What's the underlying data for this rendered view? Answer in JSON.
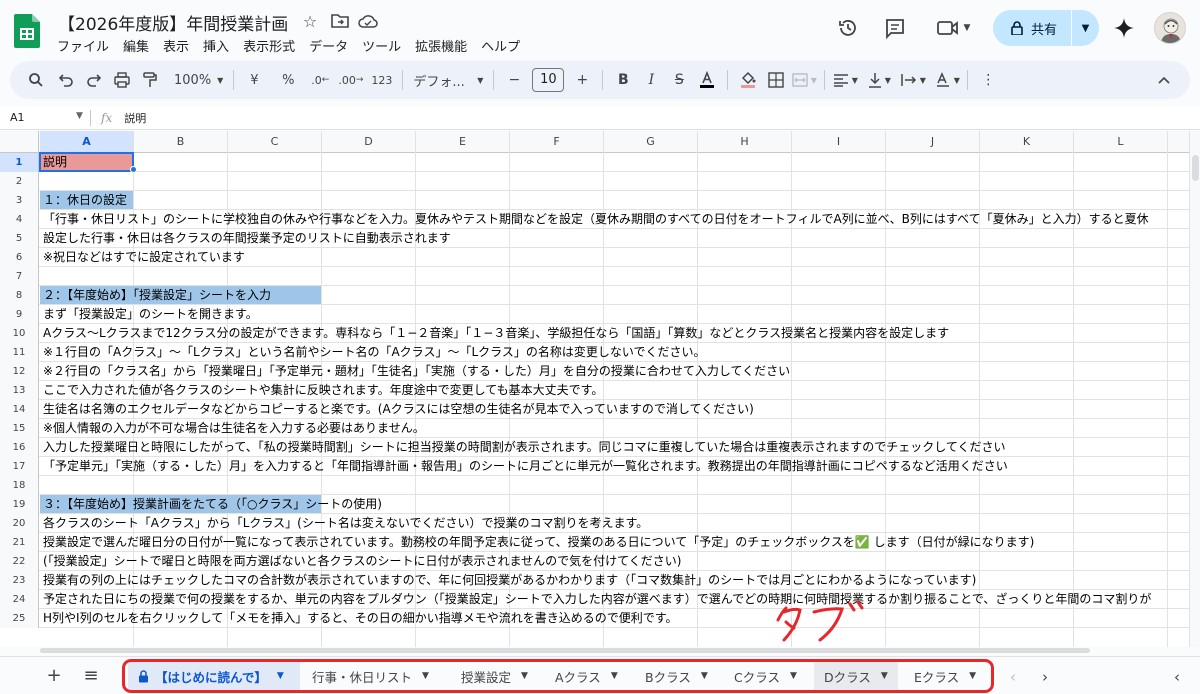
{
  "doc": {
    "title": "【2026年度版】年間授業計画"
  },
  "menu": [
    "ファイル",
    "編集",
    "表示",
    "挿入",
    "表示形式",
    "データ",
    "ツール",
    "拡張機能",
    "ヘルプ"
  ],
  "share": {
    "label": "共有"
  },
  "toolbar": {
    "zoom": "100%",
    "currency": "¥",
    "percent": "%",
    "dec_decrease": ".0",
    "dec_increase": ".00",
    "number_format": "123",
    "font": "デフォ...",
    "font_size": "10"
  },
  "formula_bar": {
    "cell_ref": "A1",
    "fx": "fx",
    "content": "説明"
  },
  "columns": [
    "A",
    "B",
    "C",
    "D",
    "E",
    "F",
    "G",
    "H",
    "I",
    "J",
    "K",
    "L"
  ],
  "rows": [
    {
      "n": "1",
      "text": "説明"
    },
    {
      "n": "2",
      "text": ""
    },
    {
      "n": "3",
      "text": "１：休日の設定"
    },
    {
      "n": "4",
      "text": "「行事・休日リスト」のシートに学校独自の休みや行事などを入力。夏休みやテスト期間などを設定（夏休み期間のすべての日付をオートフィルでA列に並べ、B列にはすべて「夏休み」と入力）すると夏休"
    },
    {
      "n": "5",
      "text": "設定した行事・休日は各クラスの年間授業予定のリストに自動表示されます"
    },
    {
      "n": "6",
      "text": "※祝日などはすでに設定されています"
    },
    {
      "n": "7",
      "text": ""
    },
    {
      "n": "8",
      "text": "２：【年度始め】「授業設定」シートを入力"
    },
    {
      "n": "9",
      "text": "まず「授業設定」のシートを開きます。"
    },
    {
      "n": "10",
      "text": "Aクラス〜Lクラスまで12クラス分の設定ができます。専科なら「１−２音楽」「１−３音楽」、学級担任なら「国語」「算数」などとクラス授業名と授業内容を設定します"
    },
    {
      "n": "11",
      "text": "※１行目の「Aクラス」〜「Lクラス」という名前やシート名の「Aクラス」〜「Lクラス」の名称は変更しないでください。"
    },
    {
      "n": "12",
      "text": "※２行目の「クラス名」から「授業曜日」「予定単元・題材」「生徒名」「実施（する・した）月」を自分の授業に合わせて入力してください"
    },
    {
      "n": "13",
      "text": "ここで入力された値が各クラスのシートや集計に反映されます。年度途中で変更しても基本大丈夫です。"
    },
    {
      "n": "14",
      "text": "生徒名は名簿のエクセルデータなどからコピーすると楽です。(Aクラスには空想の生徒名が見本で入っていますので消してください)"
    },
    {
      "n": "15",
      "text": "※個人情報の入力が不可な場合は生徒名を入力する必要はありません。"
    },
    {
      "n": "16",
      "text": "入力した授業曜日と時限にしたがって、「私の授業時間割」シートに担当授業の時間割が表示されます。同じコマに重複していた場合は重複表示されますのでチェックしてください"
    },
    {
      "n": "17",
      "text": "「予定単元」「実施（する・した）月」を入力すると「年間指導計画・報告用」のシートに月ごとに単元が一覧化されます。教務提出の年間指導計画にコピペするなど活用ください"
    },
    {
      "n": "18",
      "text": ""
    },
    {
      "n": "19",
      "text": "３：【年度始め】授業計画をたてる（「○クラス」シートの使用)"
    },
    {
      "n": "20",
      "text": "各クラスのシート「Aクラス」から「Lクラス」(シート名は変えないでください）で授業のコマ割りを考えます。"
    },
    {
      "n": "21",
      "text": "授業設定で選んだ曜日分の日付が一覧になって表示されています。勤務校の年間予定表に従って、授業のある日について「予定」のチェックボックスを✅ します（日付が緑になります)"
    },
    {
      "n": "22",
      "text": "(「授業設定」シートで曜日と時限を両方選ばないと各クラスのシートに日付が表示されませんので気を付けてください)"
    },
    {
      "n": "23",
      "text": "授業有の列の上にはチェックしたコマの合計数が表示されていますので、年に何回授業があるかわかります（「コマ数集計」のシートでは月ごとにわかるようになっています)"
    },
    {
      "n": "24",
      "text": "予定された日にちの授業で何の授業をするか、単元の内容をプルダウン（「授業設定」シートで入力した内容が選べます）で選んでどの時期に何時間授業するか割り振ることで、ざっくりと年間のコマ割りが"
    },
    {
      "n": "25",
      "text": "H列やI列のセルを右クリックして「メモを挿入」すると、その日の細かい指導メモや流れを書き込めるので便利です。"
    }
  ],
  "tabs": [
    {
      "label": "【はじめに読んで】",
      "locked": true
    },
    {
      "label": "行事・休日リスト"
    },
    {
      "label": "授業設定"
    },
    {
      "label": "Aクラス"
    },
    {
      "label": "Bクラス"
    },
    {
      "label": "Cクラス"
    },
    {
      "label": "Dクラス"
    },
    {
      "label": "Eクラス"
    }
  ],
  "colors": {
    "accent": "#0b57d0",
    "header_red": "#ea9999",
    "header_blue": "#9fc5e8",
    "annotation": "#e8272b",
    "share_bg": "#c2e7ff"
  }
}
